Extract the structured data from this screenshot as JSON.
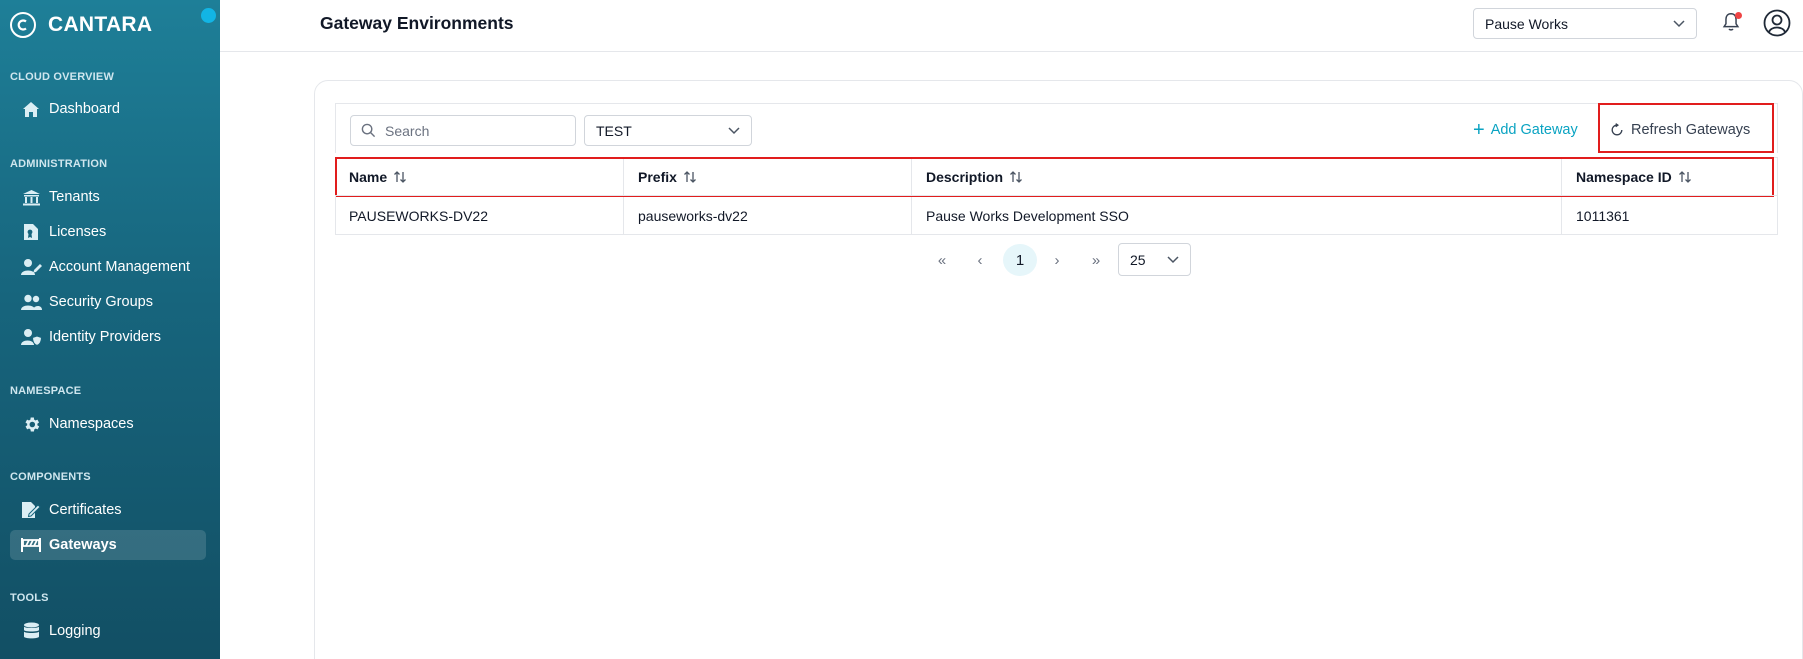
{
  "brand": {
    "name": "CANTARA"
  },
  "sidebar": {
    "sections": [
      {
        "title": "CLOUD OVERVIEW"
      },
      {
        "title": "ADMINISTRATION"
      },
      {
        "title": "NAMESPACE"
      },
      {
        "title": "COMPONENTS"
      },
      {
        "title": "TOOLS"
      }
    ],
    "items": [
      {
        "label": "Dashboard",
        "icon": "home-icon"
      },
      {
        "label": "Tenants",
        "icon": "bank-icon"
      },
      {
        "label": "Licenses",
        "icon": "license-icon"
      },
      {
        "label": "Account Management",
        "icon": "user-edit-icon"
      },
      {
        "label": "Security Groups",
        "icon": "users-icon"
      },
      {
        "label": "Identity Providers",
        "icon": "user-shield-icon"
      },
      {
        "label": "Namespaces",
        "icon": "gear-icon"
      },
      {
        "label": "Certificates",
        "icon": "certificate-icon"
      },
      {
        "label": "Gateways",
        "icon": "gateway-icon",
        "active": true
      },
      {
        "label": "Logging",
        "icon": "database-icon"
      }
    ]
  },
  "header": {
    "title": "Gateway Environments",
    "tenant": "Pause Works"
  },
  "toolbar": {
    "search_placeholder": "Search",
    "environment": "TEST",
    "add_label": "Add Gateway",
    "refresh_label": "Refresh Gateways"
  },
  "table": {
    "columns": [
      "Name",
      "Prefix",
      "Description",
      "Namespace ID"
    ],
    "rows": [
      [
        "PAUSEWORKS-DV22",
        "pauseworks-dv22",
        "Pause Works Development SSO",
        "1011361"
      ]
    ]
  },
  "pagination": {
    "first": "«",
    "prev": "‹",
    "current": "1",
    "next": "›",
    "last": "»",
    "page_size": "25"
  },
  "colors": {
    "accent": "#0aa3c2",
    "highlight": "#e11d1d",
    "sidebar": "#17657d"
  }
}
